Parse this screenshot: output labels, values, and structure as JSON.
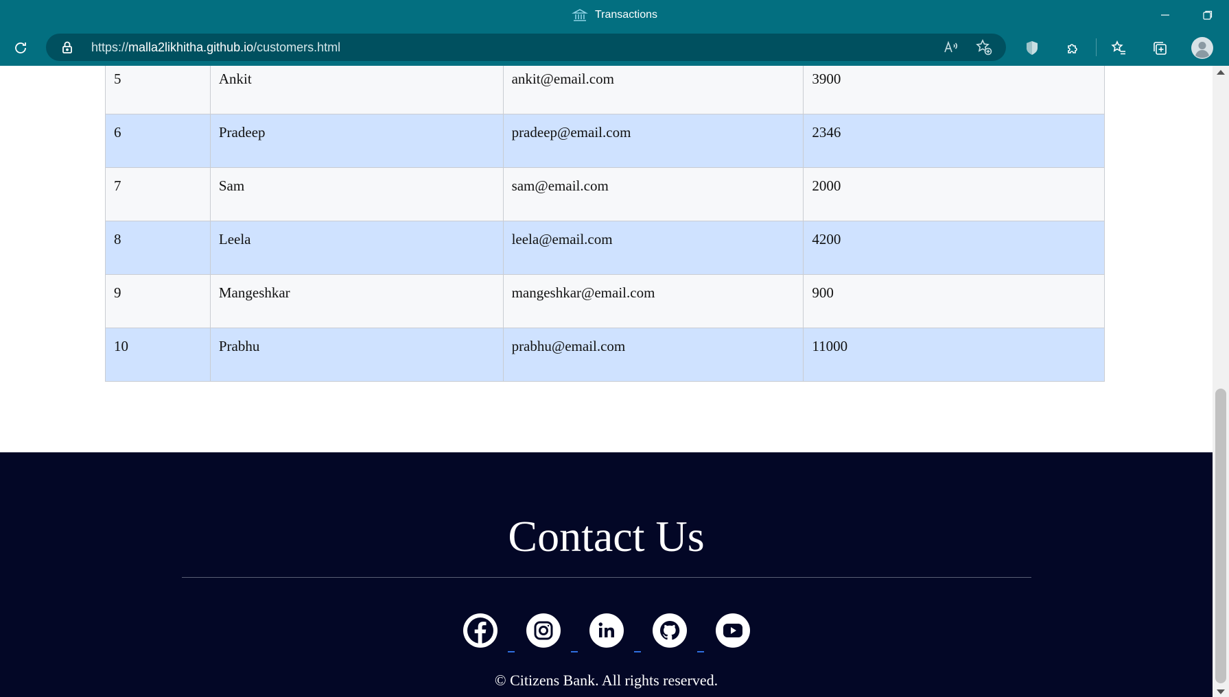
{
  "window": {
    "title": "Transactions",
    "title_icon": "bank-icon",
    "controls": [
      "minimize-icon",
      "restore-icon"
    ]
  },
  "toolbar": {
    "url_scheme": "https://",
    "url_host": "malla2likhitha.github.io",
    "url_path": "/customers.html",
    "icons": [
      "refresh-icon",
      "lock-icon",
      "read-aloud-icon",
      "add-favorite-icon",
      "shield-extension-icon",
      "extensions-icon",
      "favorites-icon",
      "collections-icon",
      "profile-avatar"
    ]
  },
  "customers": {
    "rows": [
      {
        "id": "5",
        "name": "Ankit",
        "email": "ankit@email.com",
        "balance": "3900"
      },
      {
        "id": "6",
        "name": "Pradeep",
        "email": "pradeep@email.com",
        "balance": "2346"
      },
      {
        "id": "7",
        "name": "Sam",
        "email": "sam@email.com",
        "balance": "2000"
      },
      {
        "id": "8",
        "name": "Leela",
        "email": "leela@email.com",
        "balance": "4200"
      },
      {
        "id": "9",
        "name": "Mangeshkar",
        "email": "mangeshkar@email.com",
        "balance": "900"
      },
      {
        "id": "10",
        "name": "Prabhu",
        "email": "prabhu@email.com",
        "balance": "11000"
      }
    ]
  },
  "footer": {
    "heading": "Contact Us",
    "social": [
      "facebook-icon",
      "instagram-icon",
      "linkedin-icon",
      "github-icon",
      "youtube-icon"
    ],
    "copyright": "© Citizens Bank. All rights reserved."
  },
  "colors": {
    "chrome": "#036f80",
    "address_bar": "#00505f",
    "row_alt": "#cfe2ff",
    "row_plain": "#f7f8fa",
    "footer_bg": "#030726",
    "link_underline": "#2f6fe0"
  }
}
